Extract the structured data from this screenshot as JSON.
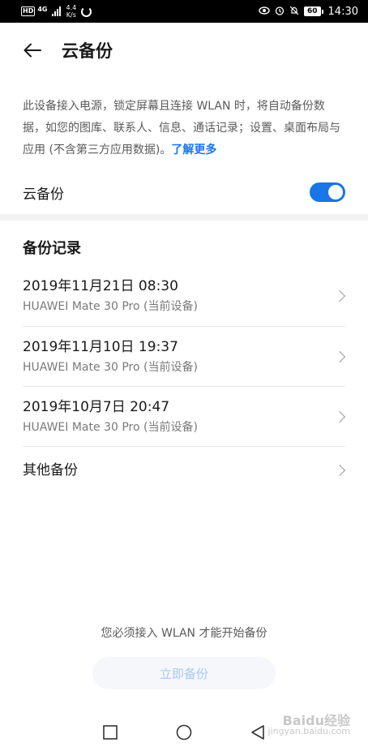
{
  "status_bar": {
    "hd": "HD",
    "network": "4G",
    "speed_value": "4.4",
    "speed_unit": "K/s",
    "battery": "60",
    "time": "14:30"
  },
  "header": {
    "title": "云备份"
  },
  "description": {
    "text": "此设备接入电源，锁定屏幕且连接 WLAN 时，将自动备份数据，如您的图库、联系人、信息、通话记录；设置、桌面布局与应用 (不含第三方应用数据)。",
    "link": "了解更多"
  },
  "toggle": {
    "label": "云备份",
    "state": "on"
  },
  "records": {
    "section_title": "备份记录",
    "items": [
      {
        "title": "2019年11月21日 08:30",
        "device": "HUAWEI Mate 30 Pro (当前设备)"
      },
      {
        "title": "2019年11月10日 19:37",
        "device": "HUAWEI Mate 30 Pro (当前设备)"
      },
      {
        "title": "2019年10月7日 20:47",
        "device": "HUAWEI Mate 30 Pro (当前设备)"
      }
    ],
    "other": "其他备份"
  },
  "footer": {
    "hint": "您必须接入 WLAN 才能开始备份",
    "button": "立即备份"
  },
  "watermark": {
    "line1": "Baidu经验",
    "line2": "jingyan.baidu.com"
  },
  "colors": {
    "accent": "#1976e8",
    "disabled_text": "#a9c8ef"
  }
}
